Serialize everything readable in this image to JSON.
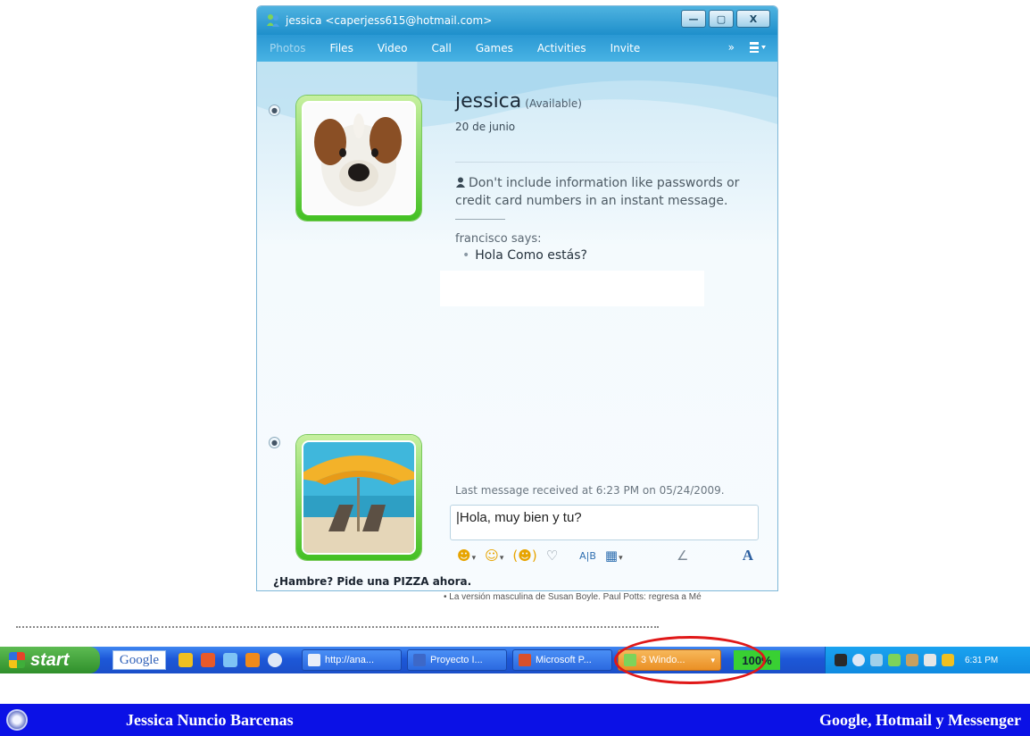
{
  "window": {
    "title": "jessica <caperjess615@hotmail.com>",
    "controls": {
      "minimize": "—",
      "maximize": "▢",
      "close": "X"
    }
  },
  "menu": {
    "items": [
      "Photos",
      "Files",
      "Video",
      "Call",
      "Games",
      "Activities",
      "Invite"
    ],
    "more": "»"
  },
  "contact": {
    "name": "jessica",
    "status": "(Available)",
    "personal_message": "20 de junio"
  },
  "conversation": {
    "warning": "Don't include information like passwords or credit card numbers in an instant message.",
    "sender_line": "francisco says:",
    "message": "Hola Como estás?",
    "last_received": "Last message received at 6:23 PM on 05/24/2009."
  },
  "compose": {
    "value": "Hola, muy bien y tu?"
  },
  "ad": {
    "text": "¿Hambre? Pide una PIZZA ahora."
  },
  "background_text": "• La versión masculina de Susan Boyle. Paul Potts: regresa a Mé",
  "taskbar": {
    "start_label": "start",
    "google_label": "Google",
    "tasks": [
      "http://ana...",
      "Proyecto I...",
      "Microsoft P...",
      "3 Windo..."
    ],
    "zoom": "100%",
    "clock": "6:31 PM"
  },
  "footer": {
    "author": "Jessica Nuncio Barcenas",
    "topic": "Google, Hotmail y Messenger"
  },
  "colors": {
    "taskbar": "#1d58d8",
    "start": "#3fa13a",
    "footer": "#0b11e6",
    "avatar_frame": "#43c023",
    "highlight": "#e01818"
  }
}
